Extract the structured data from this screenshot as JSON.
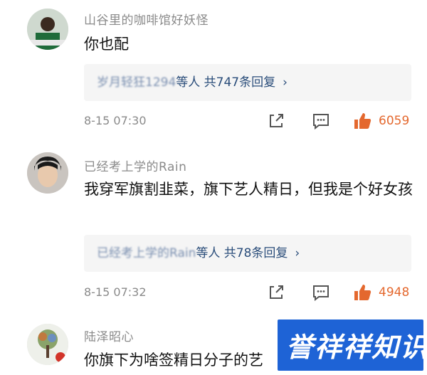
{
  "comments": [
    {
      "username": "山谷里的咖啡馆好妖怪",
      "content": "你也配",
      "reply_summary_names": "岁月轻狂1294",
      "reply_summary_rest": "等人 共747条回复",
      "time": "8-15 07:30",
      "likes": "6059"
    },
    {
      "username": "已经考上学的Rain",
      "content": "我穿军旗割韭菜，旗下艺人精日，但我是个好女孩",
      "reply_summary_names": "已经考上学的Rain",
      "reply_summary_rest": "等人 共78条回复",
      "time": "8-15 07:32",
      "likes": "4948"
    },
    {
      "username": "陆泽昭心",
      "content": "你旗下为啥签精日分子的艺"
    }
  ],
  "watermark": {
    "text": "誉祥祥知识"
  },
  "colors": {
    "like_orange": "#e4682e",
    "reply_blue": "#2a4d7a",
    "watermark_blue": "#1e63d6"
  }
}
